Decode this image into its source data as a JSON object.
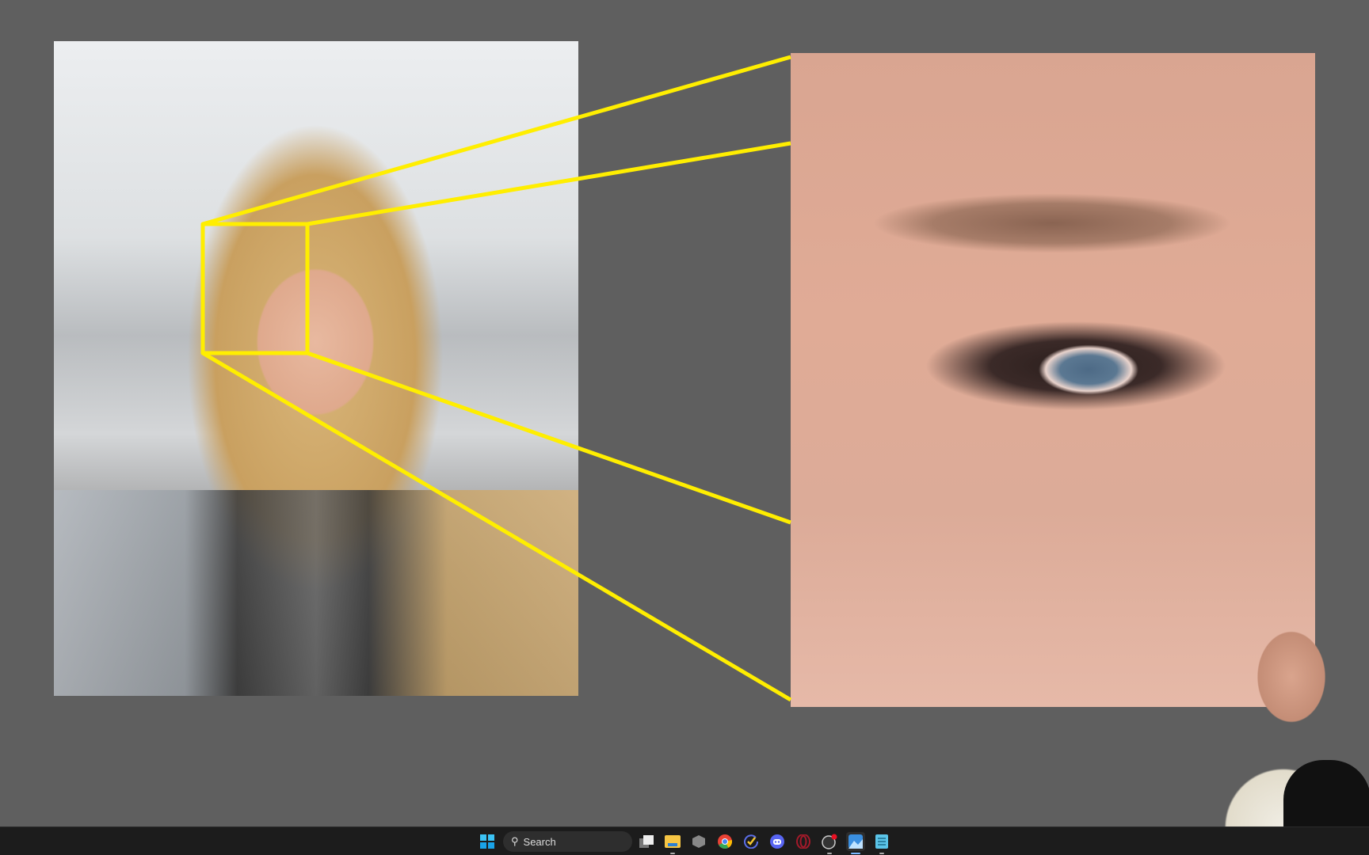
{
  "slide": {
    "background_color": "#5f5f5f",
    "highlight_color": "#ffee00",
    "images": [
      {
        "name": "portrait-photo",
        "description_icon": "image"
      },
      {
        "name": "eye-closeup-photo",
        "description_icon": "image"
      }
    ]
  },
  "taskbar": {
    "search_label": "Search",
    "icons": [
      "windows-start-icon",
      "task-view-icon",
      "file-explorer-icon",
      "app-icon",
      "chrome-icon",
      "todo-icon",
      "discord-icon",
      "opera-icon",
      "obs-icon",
      "photos-icon",
      "notepad-icon"
    ],
    "active": "photos-icon"
  }
}
